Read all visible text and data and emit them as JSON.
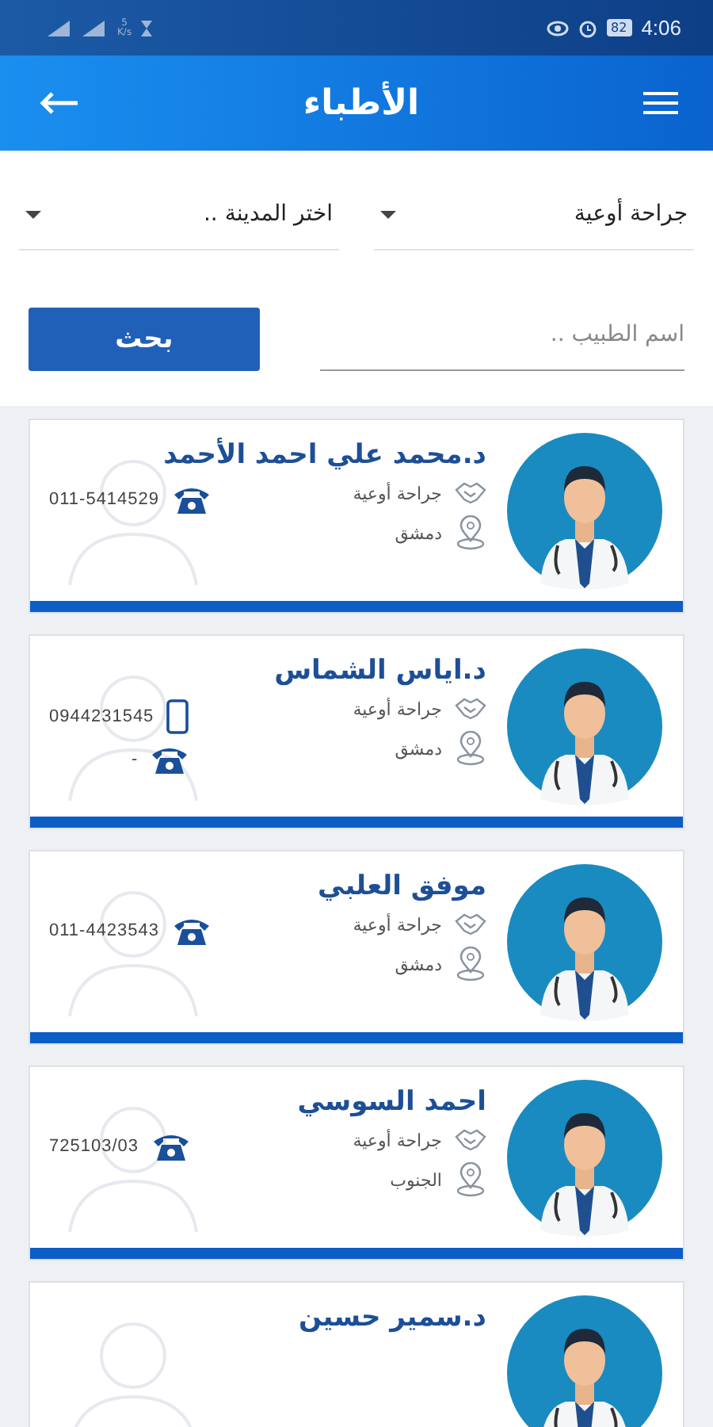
{
  "status_bar": {
    "net_speed": "5",
    "net_unit": "K/s",
    "battery": "82",
    "time": "4:06"
  },
  "app_bar": {
    "title": "الأطباء"
  },
  "filters": {
    "specialty": {
      "value": "جراحة أوعية"
    },
    "city": {
      "placeholder": "اختر المدينة .."
    },
    "doctor_name": {
      "placeholder": "اسم الطبيب .."
    },
    "search_button": "بحث"
  },
  "doctors": [
    {
      "name": "د.محمد علي احمد الأحمد",
      "specialty": "جراحة أوعية",
      "city": "دمشق",
      "contacts": [
        {
          "kind": "landline",
          "number": "011-5414529"
        }
      ]
    },
    {
      "name": "د.اياس الشماس",
      "specialty": "جراحة أوعية",
      "city": "دمشق",
      "contacts": [
        {
          "kind": "mobile",
          "number": "0944231545"
        },
        {
          "kind": "landline",
          "number": "-"
        }
      ]
    },
    {
      "name": "موفق العلبي",
      "specialty": "جراحة أوعية",
      "city": "دمشق",
      "contacts": [
        {
          "kind": "landline",
          "number": "011-4423543"
        }
      ]
    },
    {
      "name": "احمد السوسي",
      "specialty": "جراحة أوعية",
      "city": "الجنوب",
      "contacts": [
        {
          "kind": "landline",
          "number": "725103/03"
        }
      ]
    },
    {
      "name": "د.سمير حسين"
    }
  ]
}
